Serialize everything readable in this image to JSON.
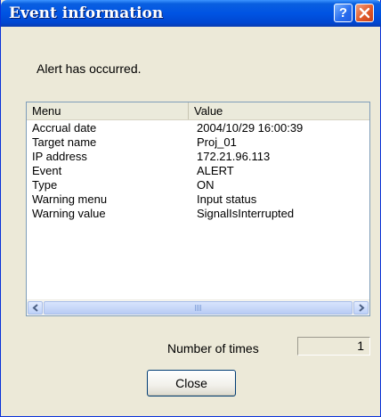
{
  "window": {
    "title": "Event information",
    "help_glyph": "?"
  },
  "alert_message": "Alert has occurred.",
  "list": {
    "columns": [
      "Menu",
      "Value"
    ],
    "rows": [
      {
        "menu": "Accrual date",
        "value": "2004/10/29 16:00:39"
      },
      {
        "menu": "Target name",
        "value": "Proj_01"
      },
      {
        "menu": "IP address",
        "value": "172.21.96.113"
      },
      {
        "menu": "Event",
        "value": "ALERT"
      },
      {
        "menu": "Type",
        "value": "ON"
      },
      {
        "menu": "Warning menu",
        "value": "Input status"
      },
      {
        "menu": "Warning value",
        "value": "SignalIsInterrupted"
      }
    ]
  },
  "count": {
    "label": "Number of times",
    "value": "1"
  },
  "buttons": {
    "close_label": "Close"
  },
  "icons": {
    "help": "question-mark-icon",
    "close": "close-x-icon",
    "scroll_left": "scroll-left-arrow-icon",
    "scroll_right": "scroll-right-arrow-icon"
  },
  "colors": {
    "titlebar": "#0054e3",
    "close_button": "#e05a2a",
    "dialog_bg": "#ece9d8"
  }
}
